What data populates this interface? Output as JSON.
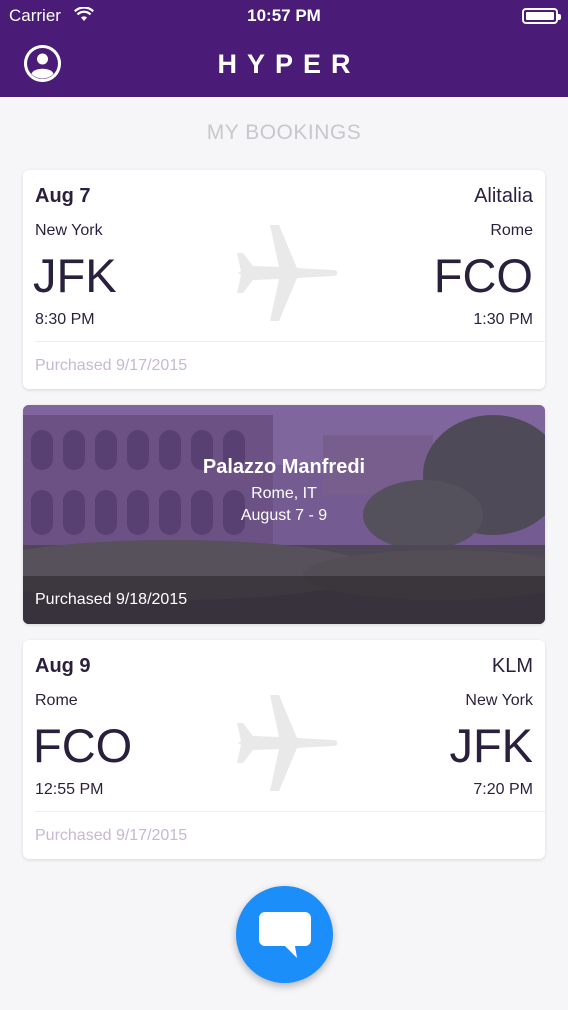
{
  "status_bar": {
    "carrier": "Carrier",
    "time": "10:57 PM"
  },
  "nav": {
    "title": "HYPER",
    "avatar_icon": "user-avatar-icon"
  },
  "section_title": "MY BOOKINGS",
  "flights": [
    {
      "date": "Aug 7",
      "airline": "Alitalia",
      "from_city": "New York",
      "to_city": "Rome",
      "from_code": "JFK",
      "to_code": "FCO",
      "depart_time": "8:30 PM",
      "arrive_time": "1:30 PM",
      "purchased": "Purchased 9/17/2015"
    },
    {
      "date": "Aug 9",
      "airline": "KLM",
      "from_city": "Rome",
      "to_city": "New York",
      "from_code": "FCO",
      "to_code": "JFK",
      "depart_time": "12:55 PM",
      "arrive_time": "7:20 PM",
      "purchased": "Purchased 9/17/2015"
    }
  ],
  "hotel": {
    "name": "Palazzo Manfredi",
    "location": "Rome, IT",
    "dates": "August 7 - 9",
    "purchased": "Purchased 9/18/2015"
  },
  "fab": {
    "icon": "chat-bubble-icon"
  },
  "colors": {
    "nav_bg": "#4a1c78",
    "fab_bg": "#1c8ef9",
    "purchased_text": "#c9b7d4",
    "section_title": "#c8c8cc"
  }
}
